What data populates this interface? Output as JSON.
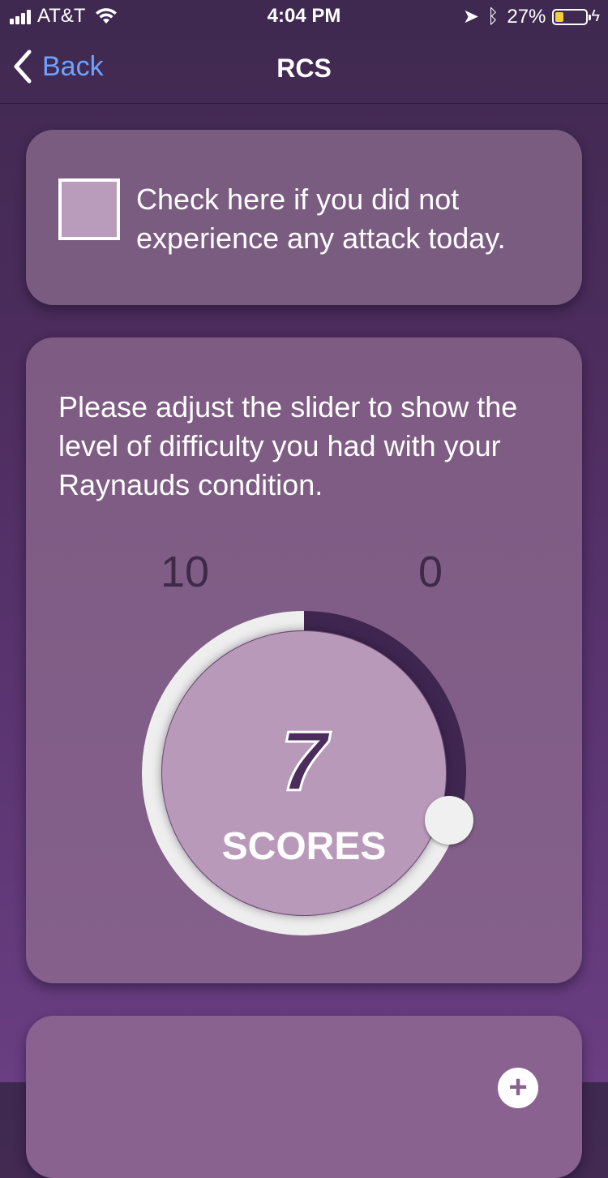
{
  "status_bar": {
    "carrier": "AT&T",
    "time": "4:04 PM",
    "battery_percent": "27%",
    "battery_level": 0.27
  },
  "nav": {
    "back_label": "Back",
    "title": "RCS"
  },
  "no_attack": {
    "label": "Check here if you did not experience any attack today.",
    "checked": false
  },
  "slider": {
    "prompt": "Please adjust the slider to show the level of difficulty you had with your Raynauds condition.",
    "scale_max_label": "10",
    "scale_min_label": "0",
    "value": 7,
    "max": 10,
    "value_display": "7",
    "unit_label": "SCORES"
  },
  "colors": {
    "track_fill": "#eeeeee",
    "track_remaining": "#3e2650",
    "accent_link": "#6ea2ff",
    "battery": "#f2cd3c"
  },
  "icons": {
    "back": "chevron-left-icon",
    "add": "plus-circle-icon"
  }
}
